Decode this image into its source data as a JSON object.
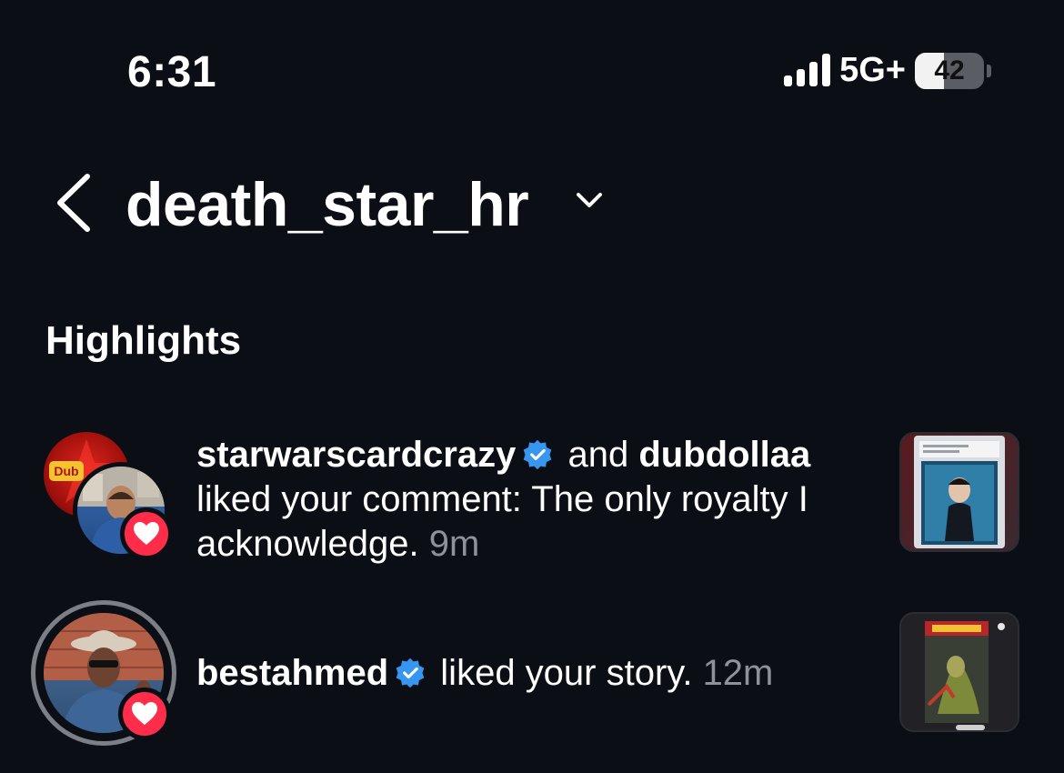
{
  "status_bar": {
    "time": "6:31",
    "network": "5G+",
    "battery_level": "42",
    "battery_fraction": 0.42
  },
  "header": {
    "back_icon": "chevron-left-icon",
    "title": "death_star_hr",
    "dropdown_icon": "chevron-down-icon"
  },
  "section": {
    "heading": "Highlights"
  },
  "notifications": [
    {
      "user1": "starwarscardcrazy",
      "user1_verified": true,
      "joiner": " and ",
      "user2": "dubdollaa",
      "action": "liked your comment: The only royalty I acknowledge.",
      "time": "9m",
      "badge_icon": "heart-icon"
    },
    {
      "user1": "bestahmed",
      "user1_verified": true,
      "action": "liked your story.",
      "time": "12m",
      "badge_icon": "heart-icon"
    }
  ],
  "colors": {
    "background": "#0b0e14",
    "verified": "#3797f0",
    "heart_badge": "#ff2d4a",
    "muted_text": "#8e9198"
  }
}
